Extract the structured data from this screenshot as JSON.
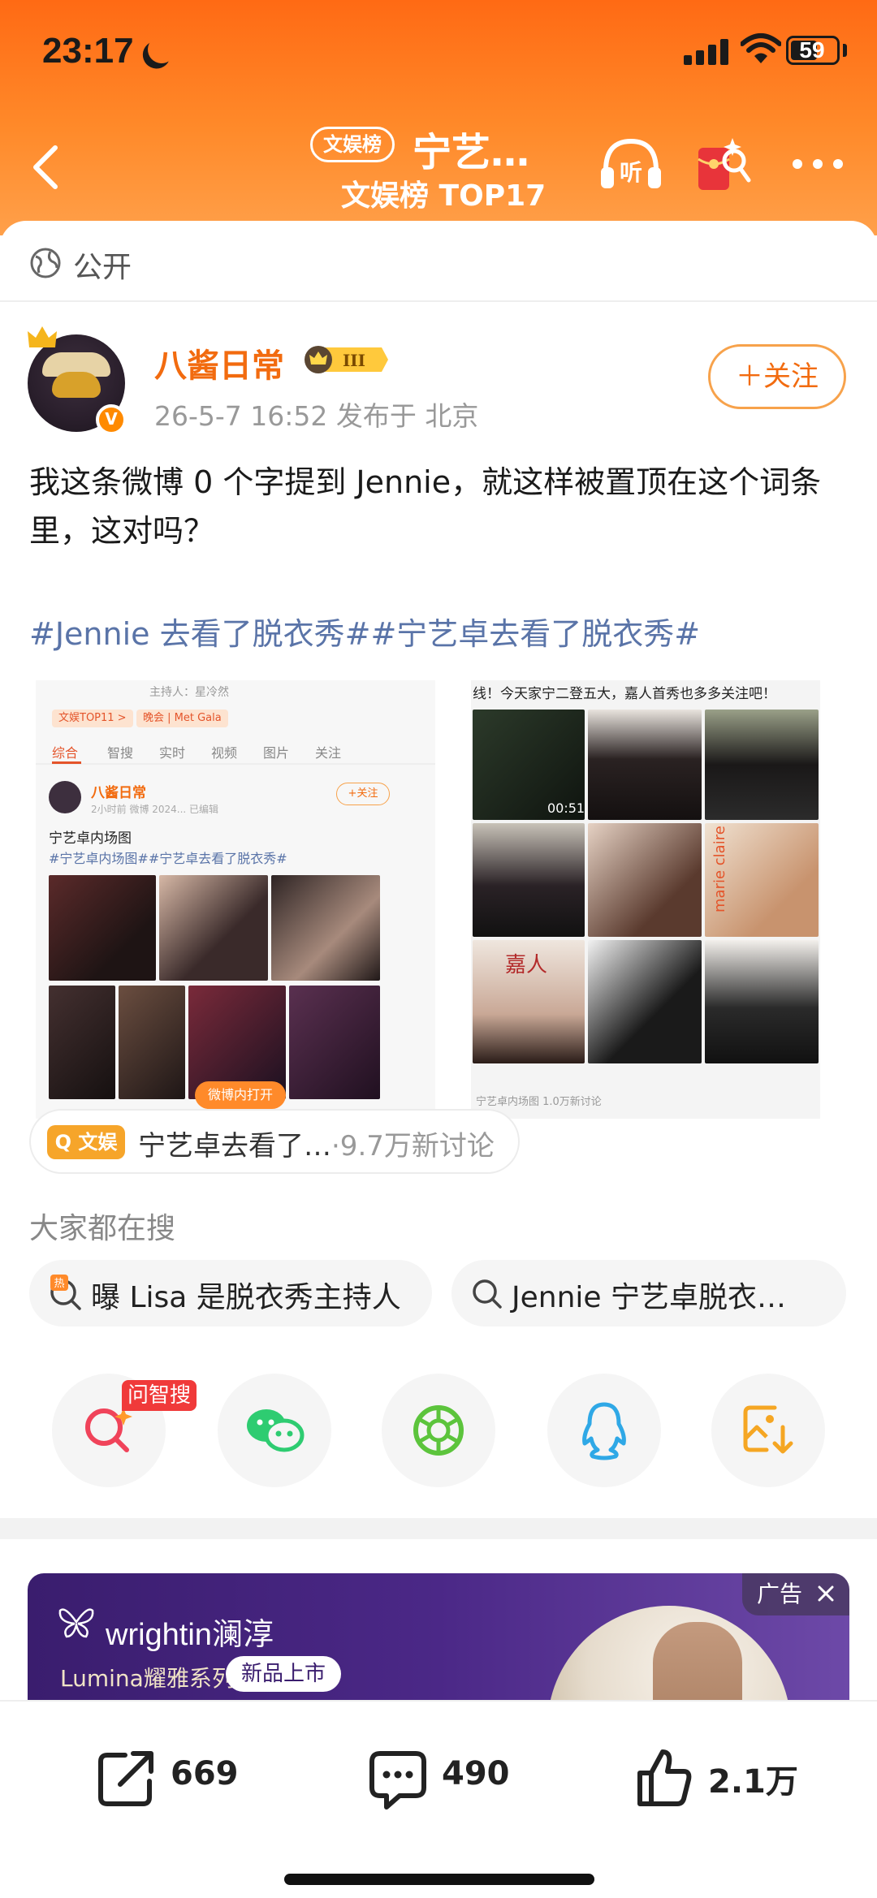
{
  "status_bar": {
    "time": "23:17",
    "battery": "59",
    "battery_level": 0.59
  },
  "nav": {
    "topic_tag": "文娱榜",
    "topic_title": "宁艺…",
    "topic_rank": "文娱榜 TOP17"
  },
  "visibility": "公开",
  "post": {
    "username": "八酱日常",
    "level_badge": "III",
    "meta": "26-5-7 16:52  发布于 北京",
    "follow_label": "＋关注",
    "text": "我这条微博 0 个字提到 Jennie，就这样被置顶在这个词条里，这对吗？",
    "hashtags": "#Jennie 去看了脱衣秀##宁艺卓去看了脱衣秀#"
  },
  "left_image": {
    "host": "主持人：星冷然",
    "rank_chip": "文娱TOP11 >",
    "event_chip": "晚会 | Met Gala",
    "tabs": [
      "综合",
      "智搜",
      "实时",
      "视频",
      "图片",
      "关注"
    ],
    "user": "八酱日常",
    "meta": "2小时前  微博 2024...  已编辑",
    "follow": "+关注",
    "title": "宁艺卓内场图",
    "tags": "#宁艺卓内场图##宁艺卓去看了脱衣秀#",
    "expand": "微博内打开"
  },
  "right_image": {
    "header": "线！今天家宁二登五大，嘉人首秀也多多关注吧！",
    "duration": "00:51",
    "footer": "宁艺卓内场图  1.0万新讨论",
    "mag1": "marie claire",
    "mag2": "嘉人"
  },
  "topic_chip": {
    "badge": "Q 文娱",
    "text": "宁艺卓去看了…",
    "count": "·9.7万新讨论"
  },
  "search": {
    "title": "大家都在搜",
    "items": [
      {
        "text": "曝 Lisa 是脱衣秀主持人"
      },
      {
        "text": "Jennie 宁艺卓脱衣…"
      }
    ]
  },
  "share": {
    "ai_tag": "问智搜",
    "items": [
      "ai-search-icon",
      "wechat-icon",
      "moments-icon",
      "qq-icon",
      "save-image-icon"
    ]
  },
  "ad": {
    "brand": "wrightin澜淳",
    "series": "Lumina耀雅系列",
    "new_label": "新品上市",
    "label": "广告"
  },
  "actions": {
    "repost": "669",
    "comment": "490",
    "like": "2.1万"
  },
  "colors": {
    "accent": "#ff7a1f",
    "username": "#f26b0f",
    "hashtag": "#5a74a8"
  }
}
